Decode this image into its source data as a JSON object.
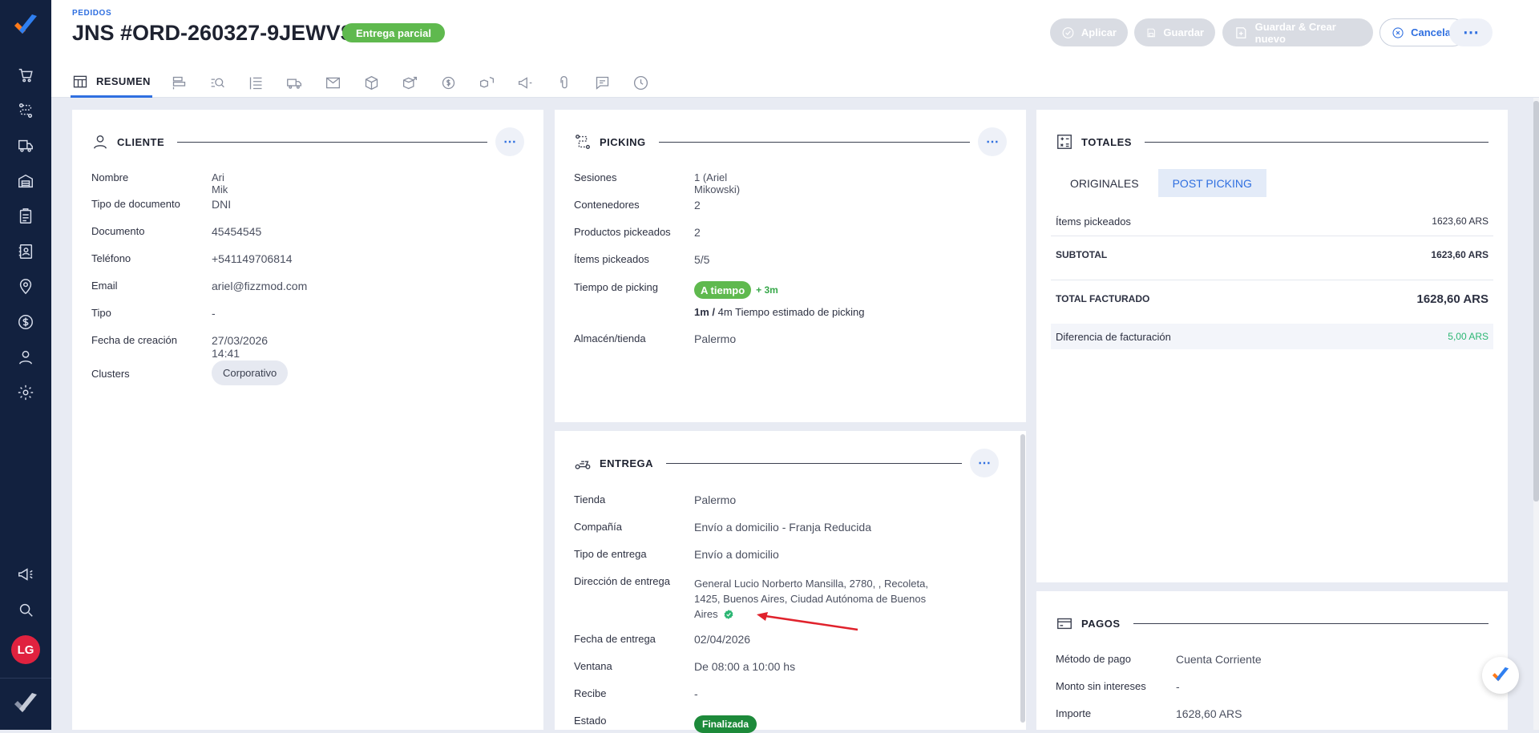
{
  "header": {
    "breadcrumb": "PEDIDOS",
    "title": "JNS #ORD-260327-9JEWVS",
    "status": "Entrega parcial",
    "buttons": {
      "apply": "Aplicar",
      "save": "Guardar",
      "save_new": "Guardar & Crear nuevo",
      "cancel": "Cancelar",
      "more": "⋯"
    }
  },
  "tabs": {
    "active": "RESUMEN",
    "icons": [
      "list-icon",
      "search-list-icon",
      "lines-icon",
      "truck-icon",
      "mail-icon",
      "box-icon",
      "box-arrow-icon",
      "dollar-icon",
      "boxes-icon",
      "megaphone-icon",
      "attachment-icon",
      "chat-icon",
      "clock-icon"
    ]
  },
  "sidebar": {
    "avatar": "LG",
    "icons": [
      "cart-icon",
      "route-icon",
      "delivery-icon",
      "warehouse-icon",
      "clipboard-icon",
      "contact-icon",
      "location-icon",
      "dollar-icon",
      "user-icon",
      "settings-icon",
      "megaphone-icon",
      "search-icon"
    ]
  },
  "cliente": {
    "title": "CLIENTE",
    "rows": [
      {
        "label": "Nombre",
        "value": "Ari Mik"
      },
      {
        "label": "Tipo de documento",
        "value": "DNI"
      },
      {
        "label": "Documento",
        "value": "45454545"
      },
      {
        "label": "Teléfono",
        "value": "+541149706814"
      },
      {
        "label": "Email",
        "value": "ariel@fizzmod.com"
      },
      {
        "label": "Tipo",
        "value": "-"
      },
      {
        "label": "Fecha de creación",
        "value": "27/03/2026 14:41"
      }
    ],
    "clusters_label": "Clusters",
    "clusters_value": "Corporativo"
  },
  "picking": {
    "title": "PICKING",
    "sesiones_label": "Sesiones",
    "sesiones_value": "1 (Ariel Mikowski)",
    "contenedores_label": "Contenedores",
    "contenedores_value": "2",
    "productos_label": "Productos pickeados",
    "productos_value": "2",
    "items_label": "Ítems pickeados",
    "items_value": "5/5",
    "tiempo_label": "Tiempo de picking",
    "tiempo_badge": "A tiempo",
    "tiempo_extra": "+ 3m",
    "tiempo_real": "1m",
    "tiempo_sep": "/",
    "tiempo_est": "4m Tiempo estimado de picking",
    "almacen_label": "Almacén/tienda",
    "almacen_value": "Palermo"
  },
  "entrega": {
    "title": "ENTREGA",
    "tienda_label": "Tienda",
    "tienda_value": "Palermo",
    "compania_label": "Compañía",
    "compania_value": "Envío a domicilio - Franja Reducida",
    "tipo_label": "Tipo de entrega",
    "tipo_value": "Envío a domicilio",
    "direccion_label": "Dirección de entrega",
    "direccion_line1": "General Lucio Norberto Mansilla, 2780, , Recoleta,",
    "direccion_line2": "1425, Buenos Aires, Ciudad Autónoma de Buenos",
    "direccion_line3": "Aires",
    "fecha_label": "Fecha de entrega",
    "fecha_value": "02/04/2026",
    "ventana_label": "Ventana",
    "ventana_value": "De 08:00 a 10:00 hs",
    "recibe_label": "Recibe",
    "recibe_value": "-",
    "estado_label": "Estado",
    "estado_value": "Finalizada"
  },
  "totales": {
    "title": "TOTALES",
    "toggle_originales": "ORIGINALES",
    "toggle_post": "POST PICKING",
    "items_label": "Ítems pickeados",
    "items_value": "1623,60 ARS",
    "subtotal_label": "SUBTOTAL",
    "subtotal_value": "1623,60 ARS",
    "total_label": "TOTAL FACTURADO",
    "total_value": "1628,60 ARS",
    "diff_label": "Diferencia de facturación",
    "diff_value": "5,00 ARS"
  },
  "pagos": {
    "title": "PAGOS",
    "metodo_label": "Método de pago",
    "metodo_value": "Cuenta Corriente",
    "monto_label": "Monto sin intereses",
    "monto_value": "-",
    "importe_label": "Importe",
    "importe_value": "1628,60 ARS"
  },
  "colors": {
    "accent": "#2f6fe0",
    "success": "#5fb94e",
    "sidebar": "#12213f",
    "annotation_arrow": "#e0222c"
  }
}
